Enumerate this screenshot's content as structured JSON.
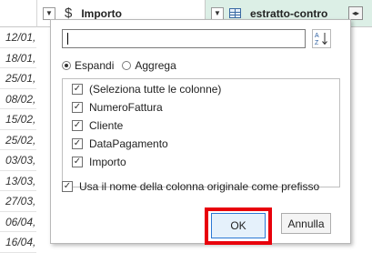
{
  "columns": {
    "importo": {
      "label": "Importo",
      "icon": "dollar-icon"
    },
    "estratto": {
      "label": "estratto-contro",
      "icon": "table-icon",
      "header_color": "#dcefe6"
    }
  },
  "rows": [
    "12/01,",
    "18/01,",
    "25/01,",
    "08/02,",
    "15/02,",
    "25/02,",
    "03/03,",
    "13/03,",
    "27/03,",
    "06/04,",
    "16/04,"
  ],
  "popup": {
    "search": {
      "value": "",
      "placeholder": ""
    },
    "sort_icon": "sort-az-icon",
    "radio": {
      "expand": "Espandi",
      "aggregate": "Aggrega",
      "selected": "Espandi"
    },
    "items": [
      {
        "label": "(Seleziona tutte le colonne)",
        "checked": true
      },
      {
        "label": "NumeroFattura",
        "checked": true
      },
      {
        "label": "Cliente",
        "checked": true
      },
      {
        "label": "DataPagamento",
        "checked": true
      },
      {
        "label": "Importo",
        "checked": true
      }
    ],
    "prefix_label": "Usa il nome della colonna originale come prefisso",
    "prefix_checked": true,
    "ok": "OK",
    "cancel": "Annulla",
    "highlight_color": "#e8000b"
  }
}
